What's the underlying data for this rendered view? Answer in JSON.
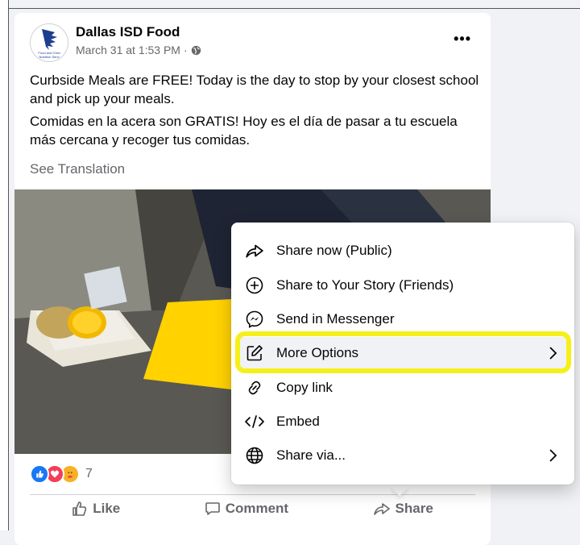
{
  "post": {
    "author": "Dallas ISD Food",
    "timestamp": "March 31 at 1:53 PM",
    "meta_sep": "·",
    "privacy_icon": "globe-icon",
    "avatar_lettering": "Food and Child Nutrition Services",
    "text_en": "Curbside Meals are FREE! Today is the day to stop by your closest school and pick up your meals.",
    "text_es": "Comidas en la acera son GRATIS! Hoy es el día de pasar a tu escuela más cercana y recoger tus comidas.",
    "see_translation": "See Translation",
    "more_icon": "more-options-dots-icon",
    "reactions": {
      "icons": [
        "like-reaction-icon",
        "love-reaction-icon",
        "care-reaction-icon"
      ],
      "count": "7"
    },
    "actions": {
      "like": "Like",
      "comment": "Comment",
      "share": "Share"
    }
  },
  "share_menu": {
    "items": [
      {
        "label": "Share now (Public)",
        "icon": "share-arrow-icon"
      },
      {
        "label": "Share to Your Story (Friends)",
        "icon": "plus-circle-icon"
      },
      {
        "label": "Send in Messenger",
        "icon": "messenger-icon"
      },
      {
        "label": "More Options",
        "icon": "edit-pencil-icon",
        "has_submenu": true,
        "highlighted": true
      },
      {
        "label": "Copy link",
        "icon": "link-icon"
      },
      {
        "label": "Embed",
        "icon": "code-icon"
      },
      {
        "label": "Share via...",
        "icon": "globe-icon",
        "has_submenu": true
      }
    ]
  },
  "colors": {
    "highlight": "#f5f019",
    "like_blue": "#1877f2",
    "love_red": "#f33e58",
    "secondary_text": "#65676b"
  }
}
